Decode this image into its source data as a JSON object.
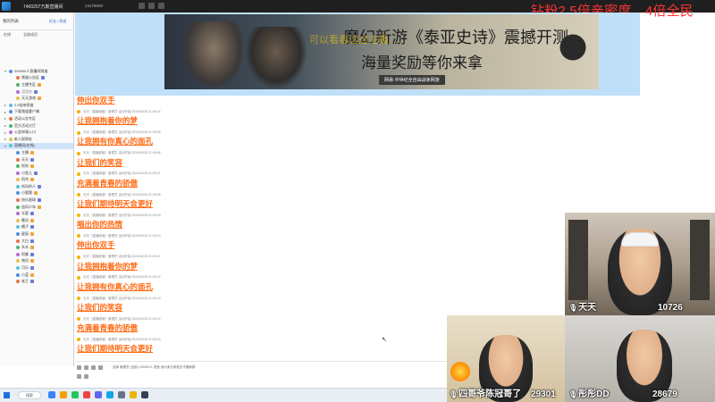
{
  "topbar": {
    "title": "7400207万斯直播间",
    "status": "24178000",
    "overlay_banner": "钻粉2.5倍亲密度，4倍全民"
  },
  "left_panel": {
    "user": "我的列表",
    "header_links": "好友 | 频道",
    "sub_a": "在线",
    "sub_b": "全部成员",
    "tree": [
      {
        "label": "200000人直播间频道",
        "level": 0,
        "toggle": "▾",
        "muted": false
      },
      {
        "label": "频道公告区",
        "level": 1,
        "toggle": "",
        "muted": false
      },
      {
        "label": "主播专区",
        "level": 1,
        "toggle": "",
        "muted": false
      },
      {
        "label": "语音房",
        "level": 1,
        "toggle": "",
        "muted": true
      },
      {
        "label": "天天游戏",
        "level": 1,
        "toggle": "",
        "muted": false
      },
      {
        "label": "2.5倍亲密度",
        "level": 0,
        "toggle": "▸",
        "muted": false
      },
      {
        "label": "下载频道客户端",
        "level": 0,
        "toggle": "▸",
        "muted": false
      },
      {
        "label": "活动公告专区",
        "level": 0,
        "toggle": "▸",
        "muted": false
      },
      {
        "label": "官方活动大厅",
        "level": 0,
        "toggle": "▸",
        "muted": false
      },
      {
        "label": "公会申请入口",
        "level": 0,
        "toggle": "▸",
        "muted": false
      },
      {
        "label": "新人报到处",
        "level": 0,
        "toggle": "▸",
        "muted": false
      },
      {
        "label": "直播间(在线)",
        "level": 0,
        "toggle": "▾",
        "muted": false,
        "selected": true
      },
      {
        "label": "主播",
        "level": 1,
        "toggle": "",
        "muted": false
      },
      {
        "label": "天天",
        "level": 1,
        "toggle": "",
        "muted": false
      },
      {
        "label": "彤彤",
        "level": 1,
        "toggle": "",
        "muted": false
      },
      {
        "label": "小鱼儿",
        "level": 1,
        "toggle": "",
        "muted": false
      },
      {
        "label": "阿杰",
        "level": 1,
        "toggle": "",
        "muted": false
      },
      {
        "label": "听风的人",
        "level": 1,
        "toggle": "",
        "muted": false
      },
      {
        "label": "小狐狸",
        "level": 1,
        "toggle": "",
        "muted": false
      },
      {
        "label": "快乐星球",
        "level": 1,
        "toggle": "",
        "muted": false
      },
      {
        "label": "追风少年",
        "level": 1,
        "toggle": "",
        "muted": false
      },
      {
        "label": "半夏",
        "level": 1,
        "toggle": "",
        "muted": false
      },
      {
        "label": "晚风",
        "level": 1,
        "toggle": "",
        "muted": false
      },
      {
        "label": "橘子",
        "level": 1,
        "toggle": "",
        "muted": false
      },
      {
        "label": "星辰",
        "level": 1,
        "toggle": "",
        "muted": false
      },
      {
        "label": "大白",
        "level": 1,
        "toggle": "",
        "muted": false
      },
      {
        "label": "木木",
        "level": 1,
        "toggle": "",
        "muted": false
      },
      {
        "label": "阿紫",
        "level": 1,
        "toggle": "",
        "muted": false
      },
      {
        "label": "南风",
        "level": 1,
        "toggle": "",
        "muted": false
      },
      {
        "label": "可乐",
        "level": 1,
        "toggle": "",
        "muted": false
      },
      {
        "label": "小蓝",
        "level": 1,
        "toggle": "",
        "muted": false
      },
      {
        "label": "老王",
        "level": 1,
        "toggle": "",
        "muted": false
      }
    ]
  },
  "ad": {
    "headline": "魔幻新游《泰亚史诗》震撼开测",
    "subline": "海量奖励等你来拿",
    "footer": "网易·中世纪全自由战争网游",
    "overlay": "可以看看这这主播……"
  },
  "chat": {
    "messages": [
      {
        "title": "伸出你双手",
        "meta": "天天（直播频道）管理员  活动开始  2024/03/26 21:09:04"
      },
      {
        "title": "让我拥抱着你的梦",
        "meta": "天天（直播频道）管理员  活动开始  2024/03/26 21:09:05"
      },
      {
        "title": "让我拥有你真心的面孔",
        "meta": "天天（直播频道）管理员  活动开始  2024/03/26 21:09:06"
      },
      {
        "title": "让我们的笑容",
        "meta": "天天（直播频道）管理员  活动开始  2024/03/26 21:09:07"
      },
      {
        "title": "充满着青春的骄傲",
        "meta": "天天（直播频道）管理员  活动开始  2024/03/26 21:09:08"
      },
      {
        "title": "让我们期待明天会更好",
        "meta": "天天（直播频道）管理员  活动开始  2024/03/26 21:09:09"
      },
      {
        "title": "唱出你的热情",
        "meta": "天天（直播频道）管理员  活动开始  2024/03/26 21:09:10"
      },
      {
        "title": "伸出你双手",
        "meta": "天天（直播频道）管理员  活动开始  2024/03/26 21:09:11"
      },
      {
        "title": "让我拥抱着你的梦",
        "meta": "天天（直播频道）管理员  活动开始  2024/03/26 21:09:12"
      },
      {
        "title": "让我拥有你真心的面孔",
        "meta": "天天（直播频道）管理员  活动开始  2024/03/26 21:09:13"
      },
      {
        "title": "让我们的笑容",
        "meta": "天天（直播频道）管理员  活动开始  2024/03/26 21:09:14"
      },
      {
        "title": "充满着青春的骄傲",
        "meta": "天天（直播频道）管理员  活动开始  2024/03/26 21:09:15"
      },
      {
        "title": "让我们期待明天会更好",
        "meta": ""
      }
    ]
  },
  "input_bar": {
    "hint": "选择  管理员  (全部) 100000人  语音  请大家文明发言不要刷屏"
  },
  "taskbar": {
    "search": "搜索"
  },
  "cams": [
    {
      "name": "天天",
      "count": "10726"
    },
    {
      "name": "四哥爷陈冠哥了",
      "count": "29301"
    },
    {
      "name": "彤彤DD",
      "count": "28679"
    }
  ],
  "colors": {
    "message_orange": "#ff6a13",
    "banner_red": "#ff3434",
    "ad_sky": "#bfe0f8",
    "selected_row": "#cfe3fb"
  }
}
